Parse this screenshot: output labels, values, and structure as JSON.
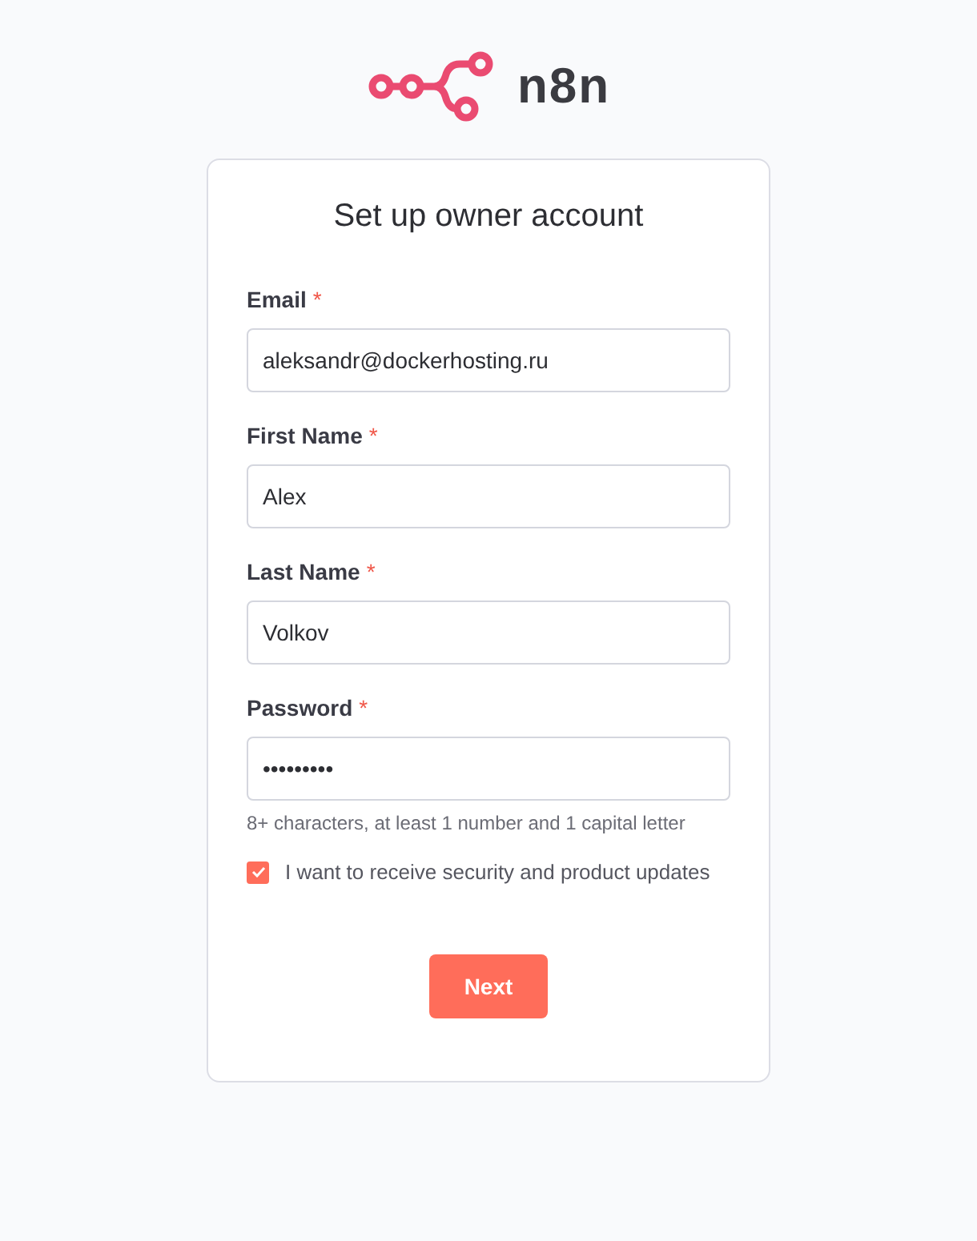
{
  "logo": {
    "text": "n8n"
  },
  "title": "Set up owner account",
  "fields": [
    {
      "label": "Email",
      "required_mark": "*",
      "value": "aleksandr@dockerhosting.ru"
    },
    {
      "label": "First Name",
      "required_mark": "*",
      "value": "Alex"
    },
    {
      "label": "Last Name",
      "required_mark": "*",
      "value": "Volkov"
    },
    {
      "label": "Password",
      "required_mark": "*",
      "value": "•••••••••",
      "hint": "8+ characters, at least 1 number and 1 capital letter"
    }
  ],
  "consent": {
    "label": "I want to receive security and product updates",
    "checked": true
  },
  "button": "Next"
}
